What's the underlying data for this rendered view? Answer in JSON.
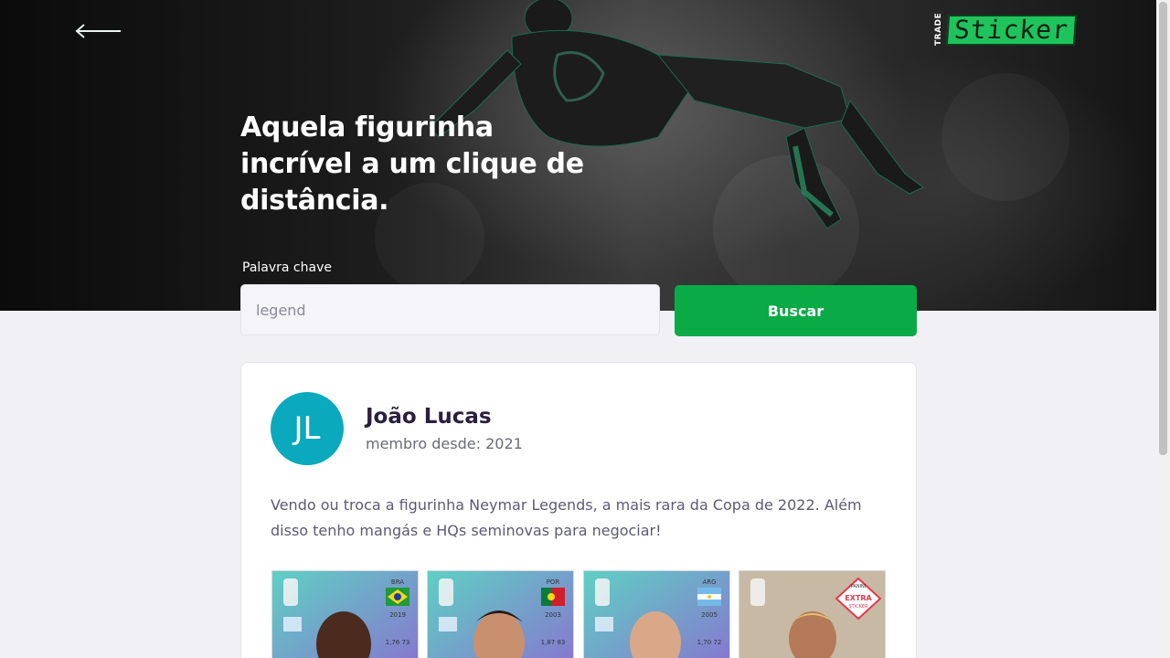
{
  "header": {
    "back_icon": "arrow-left-icon",
    "logo": {
      "small": "TRADE",
      "main": "Sticker",
      "accent": "#1fc35c"
    }
  },
  "hero": {
    "headline": "Aquela figurinha incrível a um clique de distância."
  },
  "search": {
    "label": "Palavra chave",
    "value": "legend",
    "button_label": "Buscar",
    "button_color": "#0aab47"
  },
  "post": {
    "avatar_initials": "JL",
    "avatar_color": "#0aa9bd",
    "user_name": "João Lucas",
    "member_since": "membro desde: 2021",
    "text": "Vendo ou troca a figurinha Neymar Legends, a mais rara da Copa de 2022. Além disso tenho mangás e HQs seminovas para negociar!",
    "stickers": [
      {
        "country": "BRA",
        "year": "2019",
        "stats": "1,76  73"
      },
      {
        "country": "POR",
        "year": "2003",
        "stats": "1,87  83"
      },
      {
        "country": "ARG",
        "year": "2005",
        "stats": "1,70  72"
      },
      {
        "badge_line1": "EXTRA",
        "badge_line2": "STICKER",
        "brand": "PANINI"
      }
    ]
  }
}
